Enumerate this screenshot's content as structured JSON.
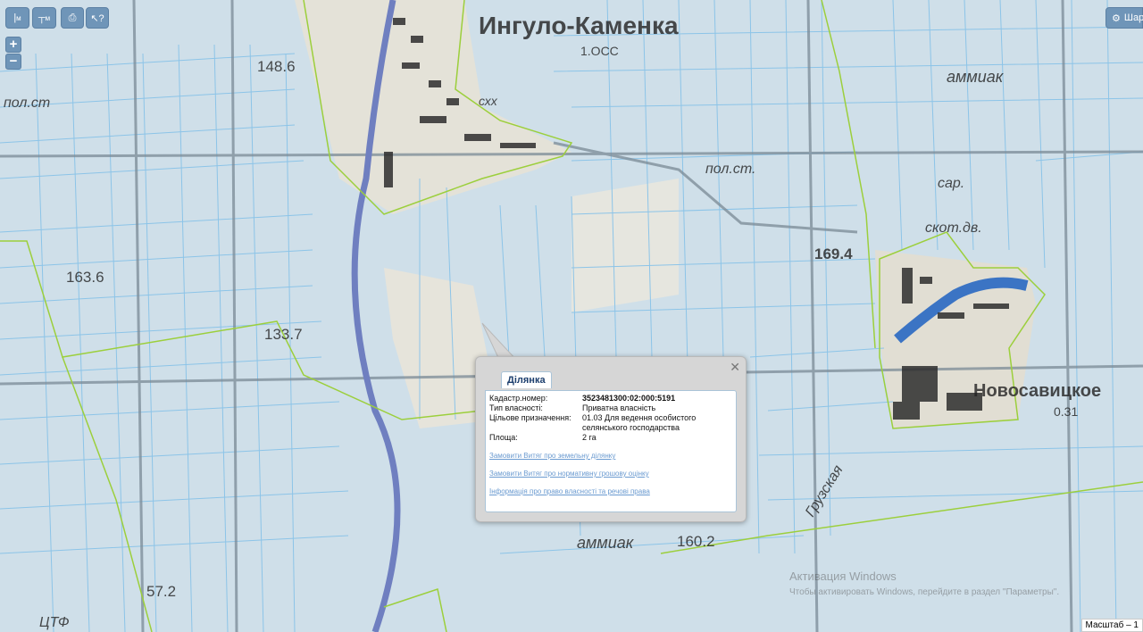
{
  "map": {
    "place_labels": [
      {
        "id": "ingulo-kamenka",
        "text": "Ингуло-Каменка"
      },
      {
        "id": "novosavitskoe",
        "text": "Новосавицкое"
      },
      {
        "id": "khutor-031",
        "text": "0.31"
      },
      {
        "id": "loss",
        "text": "1.ОСС"
      },
      {
        "id": "ammiak-ne",
        "text": "аммиак"
      },
      {
        "id": "ammiak-s",
        "text": "аммиак"
      },
      {
        "id": "pol-st-nw",
        "text": "пол.ст"
      },
      {
        "id": "pol-st-center",
        "text": "пол.ст."
      },
      {
        "id": "skh",
        "text": "схх"
      },
      {
        "id": "sar",
        "text": "сар."
      },
      {
        "id": "skot-dv",
        "text": "скот.дв."
      },
      {
        "id": "gruzskaya",
        "text": "Грузская"
      },
      {
        "id": "mtf",
        "text": "ЦТФ"
      },
      {
        "id": "elev-1486",
        "text": "148.6"
      },
      {
        "id": "elev-1636",
        "text": "163.6"
      },
      {
        "id": "elev-1337",
        "text": "133.7"
      },
      {
        "id": "elev-1694",
        "text": "169.4"
      },
      {
        "id": "elev-1602",
        "text": "160.2"
      },
      {
        "id": "elev-572",
        "text": "57.2"
      }
    ]
  },
  "toolbar": {
    "measure_length_label": "м",
    "measure_area_label": "м",
    "layers_label": "Шар"
  },
  "popup": {
    "tab_label": "Ділянка",
    "properties": [
      {
        "key": "Кадастр.номер:",
        "value": "3523481300:02:000:5191",
        "bold": true
      },
      {
        "key": "Тип власності:",
        "value": "Приватна власність"
      },
      {
        "key": "Цільове призначення:",
        "value": "01.03 Для ведення особистого селянського господарства"
      },
      {
        "key": "Площа:",
        "value": "2 га"
      }
    ],
    "links": [
      "Замовити Витяг про земельну ділянку",
      "Замовити Витяг про нормативну грошову оцінку",
      "Інформація про право власності та речові права"
    ]
  },
  "watermark": {
    "title": "Активация Windows",
    "subtitle": "Чтобы активировать Windows, перейдите в раздел \"Параметры\"."
  },
  "scale_label": "Масштаб – 1"
}
